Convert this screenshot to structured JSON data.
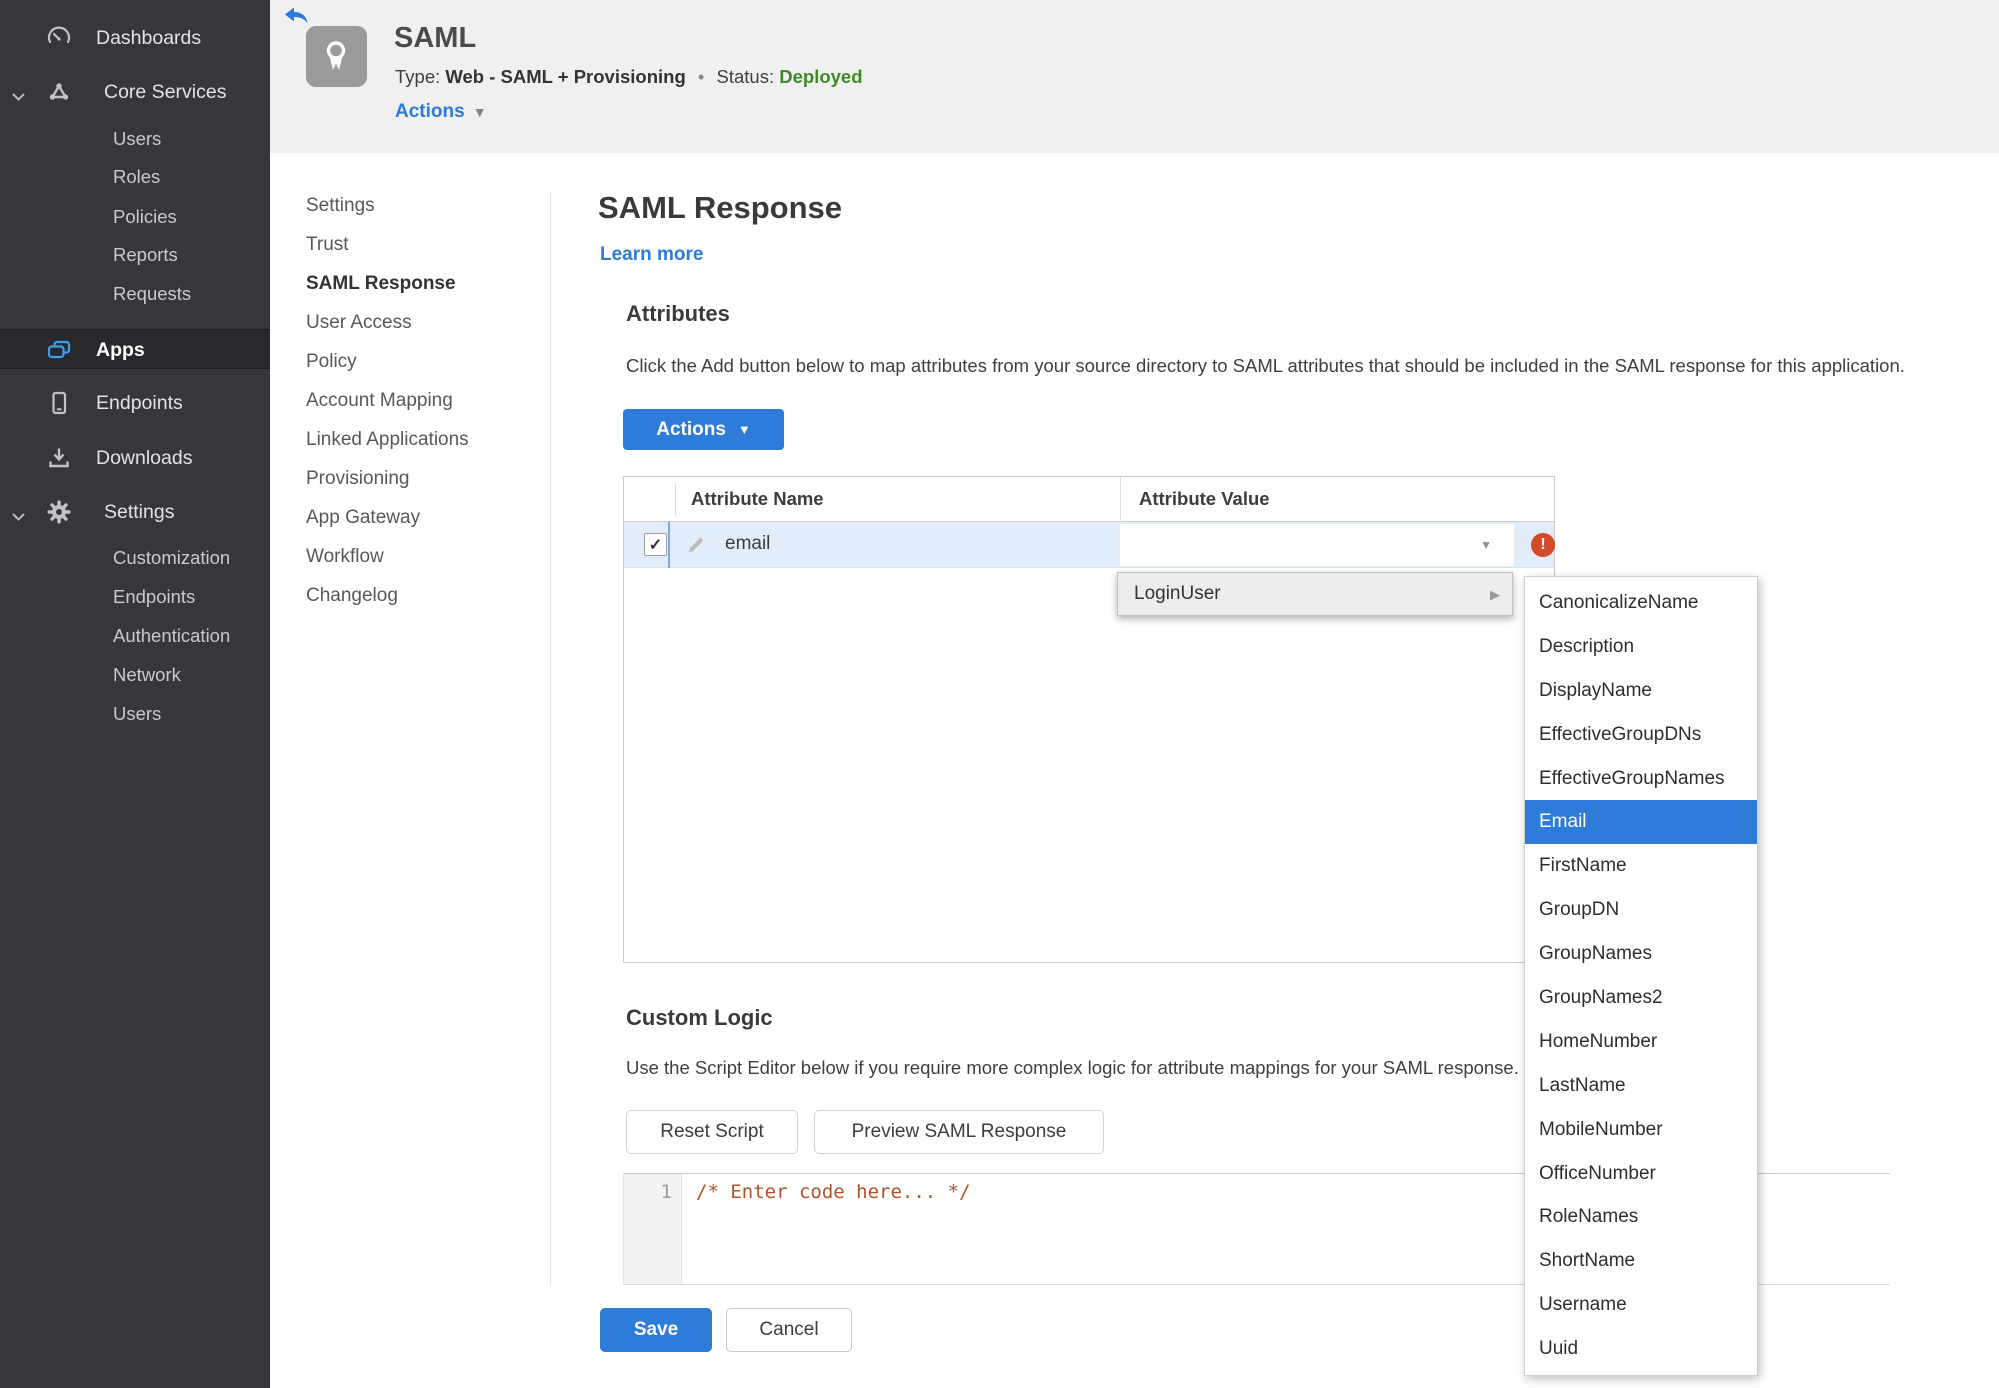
{
  "sidebar": {
    "items": [
      {
        "label": "Dashboards",
        "icon": "gauge-icon"
      },
      {
        "label": "Core Services",
        "icon": "core-services-icon",
        "expanded": true
      },
      {
        "label": "Users"
      },
      {
        "label": "Roles"
      },
      {
        "label": "Policies"
      },
      {
        "label": "Reports"
      },
      {
        "label": "Requests"
      },
      {
        "label": "Apps",
        "icon": "apps-icon",
        "active": true
      },
      {
        "label": "Endpoints",
        "icon": "phone-icon"
      },
      {
        "label": "Downloads",
        "icon": "download-icon"
      },
      {
        "label": "Settings",
        "icon": "gear-icon",
        "expanded": true
      },
      {
        "label": "Customization"
      },
      {
        "label": "Endpoints"
      },
      {
        "label": "Authentication"
      },
      {
        "label": "Network"
      },
      {
        "label": "Users"
      }
    ]
  },
  "header": {
    "title": "SAML",
    "type_label": "Type:",
    "type_value": "Web - SAML + Provisioning",
    "dot": "•",
    "status_label": "Status:",
    "status_value": "Deployed",
    "actions_label": "Actions"
  },
  "nav": {
    "items": [
      {
        "label": "Settings"
      },
      {
        "label": "Trust"
      },
      {
        "label": "SAML Response",
        "active": true
      },
      {
        "label": "User Access"
      },
      {
        "label": "Policy"
      },
      {
        "label": "Account Mapping"
      },
      {
        "label": "Linked Applications"
      },
      {
        "label": "Provisioning"
      },
      {
        "label": "App Gateway"
      },
      {
        "label": "Workflow"
      },
      {
        "label": "Changelog"
      }
    ]
  },
  "main": {
    "title": "SAML Response",
    "learn_more": "Learn more",
    "attributes": {
      "heading": "Attributes",
      "description": "Click the Add button below to map attributes from your source directory to SAML attributes that should be included in the SAML response for this application.",
      "actions_button": "Actions",
      "table": {
        "columns": [
          "Attribute Name",
          "Attribute Value"
        ],
        "row": {
          "name": "email",
          "value": "",
          "checked": true,
          "error": true
        }
      }
    },
    "menu": {
      "label": "LoginUser",
      "submenu": {
        "selected": "Email",
        "items": [
          {
            "label": "CanonicalizeName"
          },
          {
            "label": "Description"
          },
          {
            "label": "DisplayName"
          },
          {
            "label": "EffectiveGroupDNs"
          },
          {
            "label": "EffectiveGroupNames"
          },
          {
            "label": "Email"
          },
          {
            "label": "FirstName"
          },
          {
            "label": "GroupDN"
          },
          {
            "label": "GroupNames"
          },
          {
            "label": "GroupNames2"
          },
          {
            "label": "HomeNumber"
          },
          {
            "label": "LastName"
          },
          {
            "label": "MobileNumber"
          },
          {
            "label": "OfficeNumber"
          },
          {
            "label": "RoleNames"
          },
          {
            "label": "ShortName"
          },
          {
            "label": "Username"
          },
          {
            "label": "Uuid"
          }
        ]
      }
    },
    "custom_logic": {
      "heading": "Custom Logic",
      "description": "Use the Script Editor below if you require more complex logic for attribute mappings for your SAML response.",
      "reset_button": "Reset Script",
      "preview_button": "Preview SAML Response",
      "editor": {
        "line_number": "1",
        "code": "/* Enter code here... */"
      }
    },
    "footer": {
      "save": "Save",
      "cancel": "Cancel"
    }
  },
  "glyphs": {
    "caret_down": "▼",
    "submenu_arrow": "▶",
    "check": "✓",
    "error": "!"
  },
  "colors": {
    "accent_blue": "#2e7cd9",
    "link_blue": "#2b7bd9",
    "status_green": "#3e8b26",
    "error_red": "#d6492a",
    "selected_row": "#e2edf9",
    "menu_highlight": "#2e7bd9",
    "sidebar_bg": "#36373a",
    "header_bg": "#f0f0f1"
  }
}
